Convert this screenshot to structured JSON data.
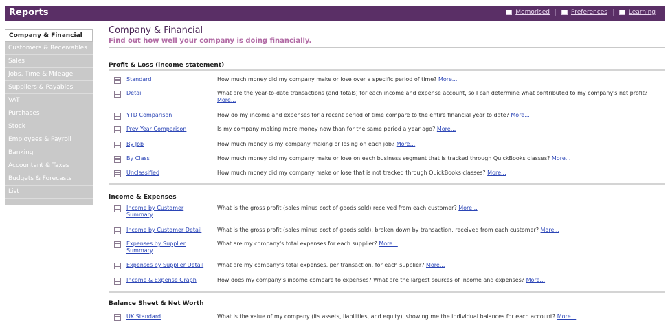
{
  "app": {
    "title": "Reports"
  },
  "toolbar": {
    "links": [
      {
        "label": "Memorised",
        "icon": "memorised-icon"
      },
      {
        "label": "Preferences",
        "icon": "preferences-icon"
      },
      {
        "label": "Learning",
        "icon": "learning-icon"
      }
    ]
  },
  "sidebar": {
    "items": [
      {
        "label": "Company & Financial",
        "active": true
      },
      {
        "label": "Customers & Receivables"
      },
      {
        "label": "Sales"
      },
      {
        "label": "Jobs, Time & Mileage"
      },
      {
        "label": "Suppliers & Payables"
      },
      {
        "label": "VAT"
      },
      {
        "label": "Purchases"
      },
      {
        "label": "Stock"
      },
      {
        "label": "Employees & Payroll"
      },
      {
        "label": "Banking"
      },
      {
        "label": "Accountant & Taxes"
      },
      {
        "label": "Budgets & Forecasts"
      },
      {
        "label": "List"
      }
    ]
  },
  "main": {
    "title": "Company & Financial",
    "subtitle": "Find out how well your company is doing financially.",
    "more_label": "More...",
    "sections": [
      {
        "title": "Profit & Loss (income statement)",
        "reports": [
          {
            "name": "Standard",
            "desc": "How much money did my company make or lose over a specific period of time?"
          },
          {
            "name": "Detail",
            "desc": "What are the year-to-date transactions (and totals) for each income and expense account, so I can determine what contributed to my company's net profit?"
          },
          {
            "name": "YTD Comparison",
            "desc": "How do my income and expenses for a recent period of time compare to the entire financial year to date?"
          },
          {
            "name": "Prev Year Comparison",
            "desc": "Is my company making more money now than for the same period a year ago?"
          },
          {
            "name": "By Job",
            "desc": "How much money is my company making or losing on each job?"
          },
          {
            "name": "By Class",
            "desc": "How much money did my company make or lose on each business segment that is tracked through QuickBooks classes?"
          },
          {
            "name": "Unclassified",
            "desc": "How much money did my company make or lose that is not tracked through QuickBooks classes?"
          }
        ]
      },
      {
        "title": "Income & Expenses",
        "reports": [
          {
            "name": "Income by Customer Summary",
            "desc": "What is the gross profit (sales minus cost of goods sold) received from each customer?"
          },
          {
            "name": "Income by Customer Detail",
            "desc": "What is the gross profit (sales minus cost of goods sold), broken down by transaction, received from each customer?"
          },
          {
            "name": "Expenses by Supplier Summary",
            "desc": "What are my company's total expenses for each supplier?"
          },
          {
            "name": "Expenses by Supplier Detail",
            "desc": "What are my company's total expenses, per transaction, for each supplier?"
          },
          {
            "name": "Income & Expense Graph",
            "desc": "How does my company's income compare to expenses? What are the largest sources of income and expenses?"
          }
        ]
      },
      {
        "title": "Balance Sheet & Net Worth",
        "reports": [
          {
            "name": "UK Standard",
            "desc": "What is the value of my company (its assets, liabilities, and equity), showing me the individual balances for each account?"
          }
        ]
      }
    ]
  }
}
